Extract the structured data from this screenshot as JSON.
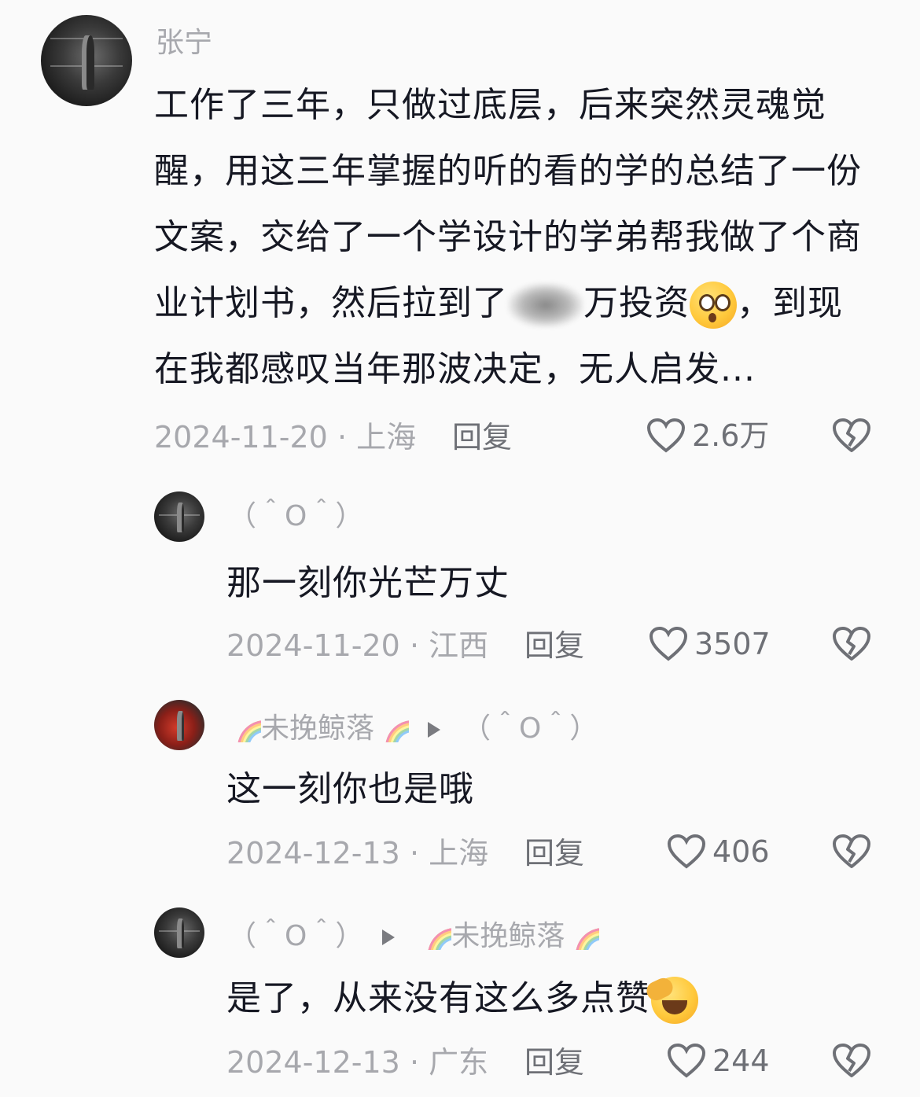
{
  "comments": [
    {
      "username": "张宁",
      "text_before_blur": "工作了三年，只做过底层，后来突然灵魂觉醒，用这三年掌握的听的看的学的总结了一份文案，交给了一个学设计的学弟帮我做了个商业计划书，然后拉到了",
      "blurred_value": "20",
      "text_after_blur": "万投资",
      "text_tail": "，到现在我都感叹当年那波决定，无人启发...",
      "date": "2024-11-20",
      "location": "上海",
      "reply_label": "回复",
      "likes": "2.6万"
    },
    {
      "username": "（＾O＾）",
      "text": "那一刻你光芒万丈",
      "date": "2024-11-20",
      "location": "江西",
      "reply_label": "回复",
      "likes": "3507"
    },
    {
      "username": "未挽鲸落",
      "reply_to": "（＾O＾）",
      "text": "这一刻你也是哦",
      "date": "2024-12-13",
      "location": "上海",
      "reply_label": "回复",
      "likes": "406"
    },
    {
      "username": "（＾O＾）",
      "reply_to": "未挽鲸落",
      "text": "是了，从来没有这么多点赞",
      "date": "2024-12-13",
      "location": "广东",
      "reply_label": "回复",
      "likes": "244"
    }
  ],
  "separator": "·",
  "icons": {
    "like": "heart-outline-icon",
    "dislike": "broken-heart-icon",
    "reply_arrow": "triangle-right-icon",
    "rainbow": "rainbow-emoji",
    "shock": "shocked-face-emoji",
    "laugh": "rolling-laughing-face-emoji"
  },
  "colors": {
    "background": "#fafafa",
    "text": "#161823",
    "secondary": "#a7a8ad",
    "action": "#6e7076"
  }
}
